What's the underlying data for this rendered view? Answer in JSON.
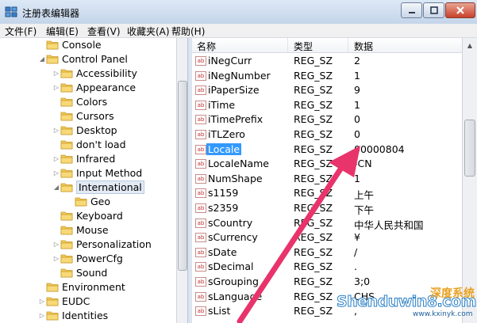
{
  "window": {
    "title": "注册表编辑器",
    "icon": "registry-editor-icon",
    "controls": [
      "minimize-icon",
      "maximize-icon",
      "close-icon"
    ]
  },
  "menubar": {
    "items": [
      "文件(F)",
      "编辑(E)",
      "查看(V)",
      "收藏夹(A)",
      "帮助(H)"
    ]
  },
  "tree": {
    "items": [
      {
        "label": "Console",
        "depth": 0,
        "expanded": false,
        "has_arrow": false
      },
      {
        "label": "Control Panel",
        "depth": 0,
        "expanded": true,
        "has_arrow": true
      },
      {
        "label": "Accessibility",
        "depth": 1,
        "expanded": false,
        "has_arrow": true
      },
      {
        "label": "Appearance",
        "depth": 1,
        "expanded": false,
        "has_arrow": true
      },
      {
        "label": "Colors",
        "depth": 1,
        "expanded": false,
        "has_arrow": false
      },
      {
        "label": "Cursors",
        "depth": 1,
        "expanded": false,
        "has_arrow": false
      },
      {
        "label": "Desktop",
        "depth": 1,
        "expanded": false,
        "has_arrow": true
      },
      {
        "label": "don't load",
        "depth": 1,
        "expanded": false,
        "has_arrow": false
      },
      {
        "label": "Infrared",
        "depth": 1,
        "expanded": false,
        "has_arrow": true
      },
      {
        "label": "Input Method",
        "depth": 1,
        "expanded": false,
        "has_arrow": true
      },
      {
        "label": "International",
        "depth": 1,
        "expanded": true,
        "has_arrow": true,
        "selected": true
      },
      {
        "label": "Geo",
        "depth": 2,
        "expanded": false,
        "has_arrow": false
      },
      {
        "label": "Keyboard",
        "depth": 1,
        "expanded": false,
        "has_arrow": false
      },
      {
        "label": "Mouse",
        "depth": 1,
        "expanded": false,
        "has_arrow": false
      },
      {
        "label": "Personalization",
        "depth": 1,
        "expanded": false,
        "has_arrow": true
      },
      {
        "label": "PowerCfg",
        "depth": 1,
        "expanded": false,
        "has_arrow": true
      },
      {
        "label": "Sound",
        "depth": 1,
        "expanded": false,
        "has_arrow": false
      },
      {
        "label": "Environment",
        "depth": 0,
        "expanded": false,
        "has_arrow": false
      },
      {
        "label": "EUDC",
        "depth": 0,
        "expanded": false,
        "has_arrow": true
      },
      {
        "label": "Identities",
        "depth": 0,
        "expanded": false,
        "has_arrow": true
      }
    ]
  },
  "list": {
    "columns": [
      "名称",
      "类型",
      "数据"
    ],
    "rows": [
      {
        "name": "iNegCurr",
        "type": "REG_SZ",
        "data": "2"
      },
      {
        "name": "iNegNumber",
        "type": "REG_SZ",
        "data": "1"
      },
      {
        "name": "iPaperSize",
        "type": "REG_SZ",
        "data": "9"
      },
      {
        "name": "iTime",
        "type": "REG_SZ",
        "data": "1"
      },
      {
        "name": "iTimePrefix",
        "type": "REG_SZ",
        "data": "0"
      },
      {
        "name": "iTLZero",
        "type": "REG_SZ",
        "data": "0"
      },
      {
        "name": "Locale",
        "type": "REG_SZ",
        "data": "00000804",
        "selected": true
      },
      {
        "name": "LocaleName",
        "type": "REG_SZ",
        "data": "-CN"
      },
      {
        "name": "NumShape",
        "type": "REG_SZ",
        "data": "1"
      },
      {
        "name": "s1159",
        "type": "REG_SZ",
        "data": "上午"
      },
      {
        "name": "s2359",
        "type": "REG_SZ",
        "data": "下午"
      },
      {
        "name": "sCountry",
        "type": "REG_SZ",
        "data": "中华人民共和国"
      },
      {
        "name": "sCurrency",
        "type": "REG_SZ",
        "data": "¥"
      },
      {
        "name": "sDate",
        "type": "REG_SZ",
        "data": "/"
      },
      {
        "name": "sDecimal",
        "type": "REG_SZ",
        "data": "."
      },
      {
        "name": "sGrouping",
        "type": "REG_SZ",
        "data": "3;0"
      },
      {
        "name": "sLanguage",
        "type": "REG_SZ",
        "data": "CHS"
      },
      {
        "name": "sList",
        "type": "REG_SZ",
        "data": ","
      }
    ],
    "value_icon_text": "ab"
  },
  "annotation": {
    "color": "#e8336b"
  },
  "watermark": {
    "main": "Shenduwin8.com",
    "cn": "深度系统",
    "sub": "www.kxinyk.com"
  }
}
